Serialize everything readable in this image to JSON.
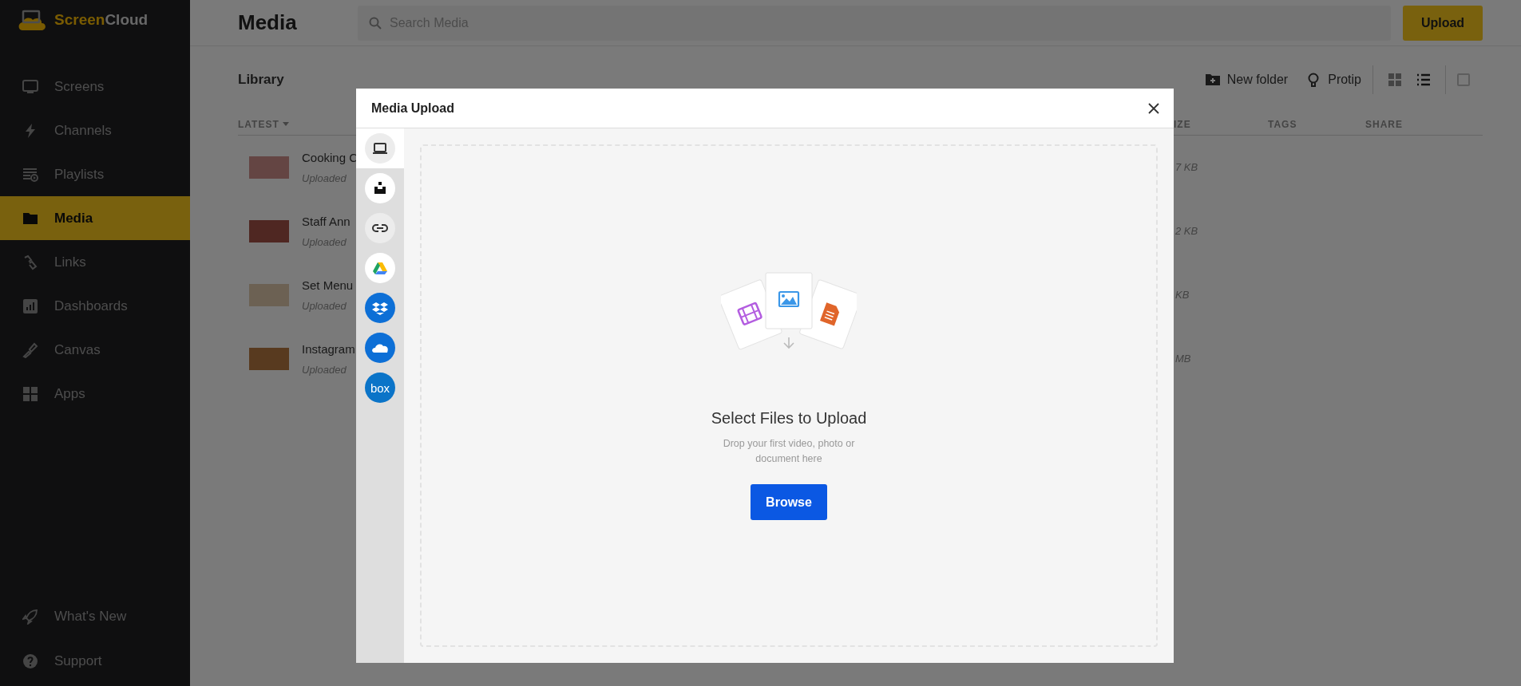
{
  "sidebar": {
    "logo_parts": [
      "Screen",
      "Cloud"
    ],
    "nav": [
      {
        "label": "Screens",
        "selected": false
      },
      {
        "label": "Channels",
        "selected": false
      },
      {
        "label": "Playlists",
        "selected": false
      },
      {
        "label": "Media",
        "selected": true
      },
      {
        "label": "Links",
        "selected": false
      },
      {
        "label": "Dashboards",
        "selected": false
      },
      {
        "label": "Canvas",
        "selected": false
      },
      {
        "label": "Apps",
        "selected": false
      }
    ],
    "footer": [
      {
        "label": "What's New"
      },
      {
        "label": "Support"
      }
    ]
  },
  "header": {
    "title": "Media",
    "search": {
      "placeholder": "Search Media"
    },
    "upload_button": "Upload"
  },
  "library": {
    "title": "Library",
    "actions": [
      {
        "label": "New folder"
      },
      {
        "label": "Protip"
      }
    ],
    "views": [
      {
        "kind": "grid",
        "selected": false
      },
      {
        "kind": "list",
        "selected": true
      }
    ],
    "select_all": {
      "checked": false
    },
    "columns": [
      {
        "label": "LATEST",
        "sorted": true
      },
      {
        "label": "IZE",
        "sorted": false
      },
      {
        "label": "TAGS",
        "sorted": false
      },
      {
        "label": "SHARE",
        "sorted": false
      }
    ],
    "rows": [
      {
        "name": "Cooking C",
        "subtitle": "Uploaded",
        "size": "7 KB"
      },
      {
        "name": "Staff Ann",
        "subtitle": "Uploaded",
        "size": "2 KB"
      },
      {
        "name": "Set Menu",
        "subtitle": "Uploaded",
        "size": "KB"
      },
      {
        "name": "Instagram",
        "subtitle": "Uploaded",
        "size": "MB"
      }
    ]
  },
  "modal": {
    "title": "Media Upload",
    "sources": [
      {
        "kind": "laptop",
        "selected": true
      },
      {
        "kind": "tray",
        "selected": false
      },
      {
        "kind": "link",
        "selected": false
      },
      {
        "kind": "triangle",
        "selected": false
      },
      {
        "kind": "boxes",
        "selected": false
      },
      {
        "kind": "cloud",
        "selected": false
      },
      {
        "kind": "text",
        "label": "box",
        "selected": false
      }
    ],
    "dropzone": {
      "title": "Select Files to Upload",
      "description": "Drop your first video, photo or document here",
      "button": "Browse"
    }
  }
}
